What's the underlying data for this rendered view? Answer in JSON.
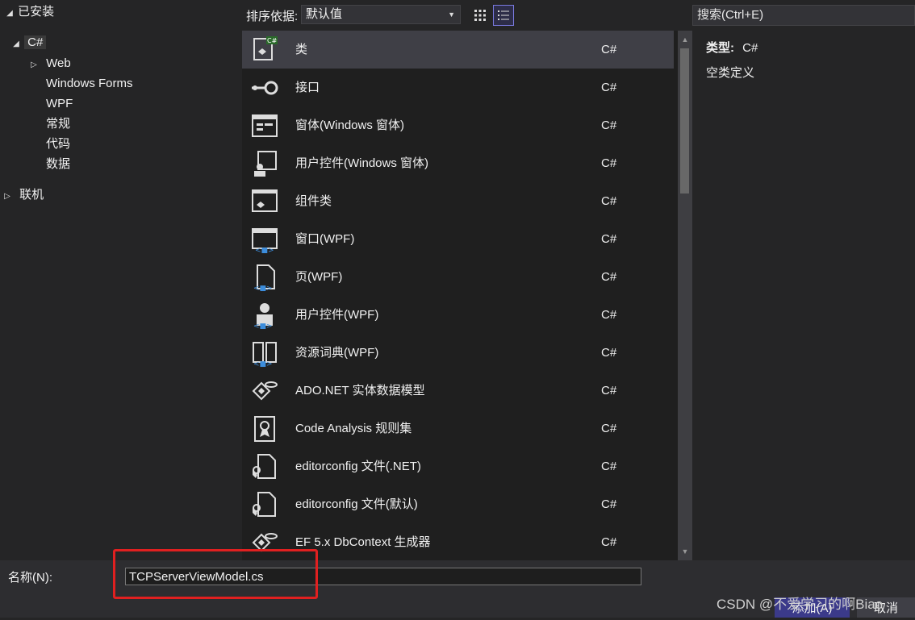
{
  "left_tree": {
    "installed": "已安装",
    "csharp": "C#",
    "children": [
      "Web",
      "Windows Forms",
      "WPF",
      "常规",
      "代码",
      "数据"
    ],
    "online": "联机"
  },
  "toolbar": {
    "sort_label": "排序依据:",
    "sort_value": "默认值",
    "grid_view_icon": "grid-view-icon",
    "list_view_icon": "list-view-icon"
  },
  "search": {
    "placeholder": "搜索(Ctrl+E)"
  },
  "templates": [
    {
      "name": "类",
      "lang": "C#",
      "icon": "class-icon"
    },
    {
      "name": "接口",
      "lang": "C#",
      "icon": "interface-icon"
    },
    {
      "name": "窗体(Windows 窗体)",
      "lang": "C#",
      "icon": "windows-form-icon"
    },
    {
      "name": "用户控件(Windows 窗体)",
      "lang": "C#",
      "icon": "user-control-icon"
    },
    {
      "name": "组件类",
      "lang": "C#",
      "icon": "component-class-icon"
    },
    {
      "name": "窗口(WPF)",
      "lang": "C#",
      "icon": "wpf-window-icon"
    },
    {
      "name": "页(WPF)",
      "lang": "C#",
      "icon": "wpf-page-icon"
    },
    {
      "name": "用户控件(WPF)",
      "lang": "C#",
      "icon": "wpf-user-control-icon"
    },
    {
      "name": "资源词典(WPF)",
      "lang": "C#",
      "icon": "resource-dictionary-icon"
    },
    {
      "name": "ADO.NET 实体数据模型",
      "lang": "C#",
      "icon": "entity-model-icon"
    },
    {
      "name": "Code Analysis 规则集",
      "lang": "C#",
      "icon": "ruleset-icon"
    },
    {
      "name": "editorconfig 文件(.NET)",
      "lang": "C#",
      "icon": "editorconfig-icon"
    },
    {
      "name": "editorconfig 文件(默认)",
      "lang": "C#",
      "icon": "editorconfig-icon"
    },
    {
      "name": "EF 5.x DbContext 生成器",
      "lang": "C#",
      "icon": "dbcontext-generator-icon"
    }
  ],
  "selected_index": 0,
  "details": {
    "type_label": "类型:",
    "type_value": "C#",
    "description": "空类定义"
  },
  "bottom": {
    "name_label": "名称(N):",
    "name_value": "TCPServerViewModel.cs",
    "add_label": "添加(A)",
    "cancel_label": "取消"
  },
  "watermark": "CSDN @不爱学习的啊Biao",
  "colors": {
    "background": "#252526",
    "list_background": "#1f1f1f",
    "selected_row": "#3f3f46",
    "accent": "#3b3a8a",
    "highlight_border": "#e02020"
  }
}
